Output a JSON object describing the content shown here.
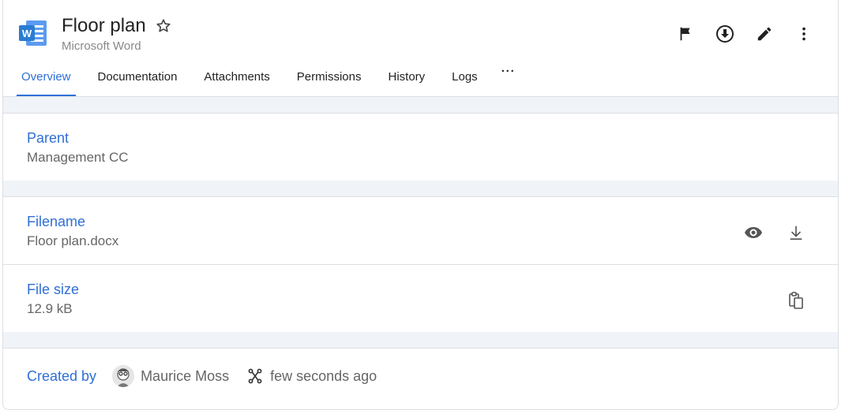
{
  "header": {
    "title": "Floor plan",
    "subtitle": "Microsoft Word",
    "app_icon_letter": "W"
  },
  "tabs": [
    {
      "label": "Overview",
      "active": true
    },
    {
      "label": "Documentation"
    },
    {
      "label": "Attachments"
    },
    {
      "label": "Permissions"
    },
    {
      "label": "History"
    },
    {
      "label": "Logs"
    },
    {
      "label": "···"
    }
  ],
  "parent": {
    "label": "Parent",
    "value": "Management CC"
  },
  "file": {
    "filename_label": "Filename",
    "filename": "Floor plan.docx",
    "size_label": "File size",
    "size": "12.9 kB"
  },
  "created": {
    "label": "Created by",
    "user": "Maurice Moss",
    "time": "few seconds ago"
  },
  "colors": {
    "accent": "#2f6fd6",
    "word_blue": "#2b7cd3"
  }
}
